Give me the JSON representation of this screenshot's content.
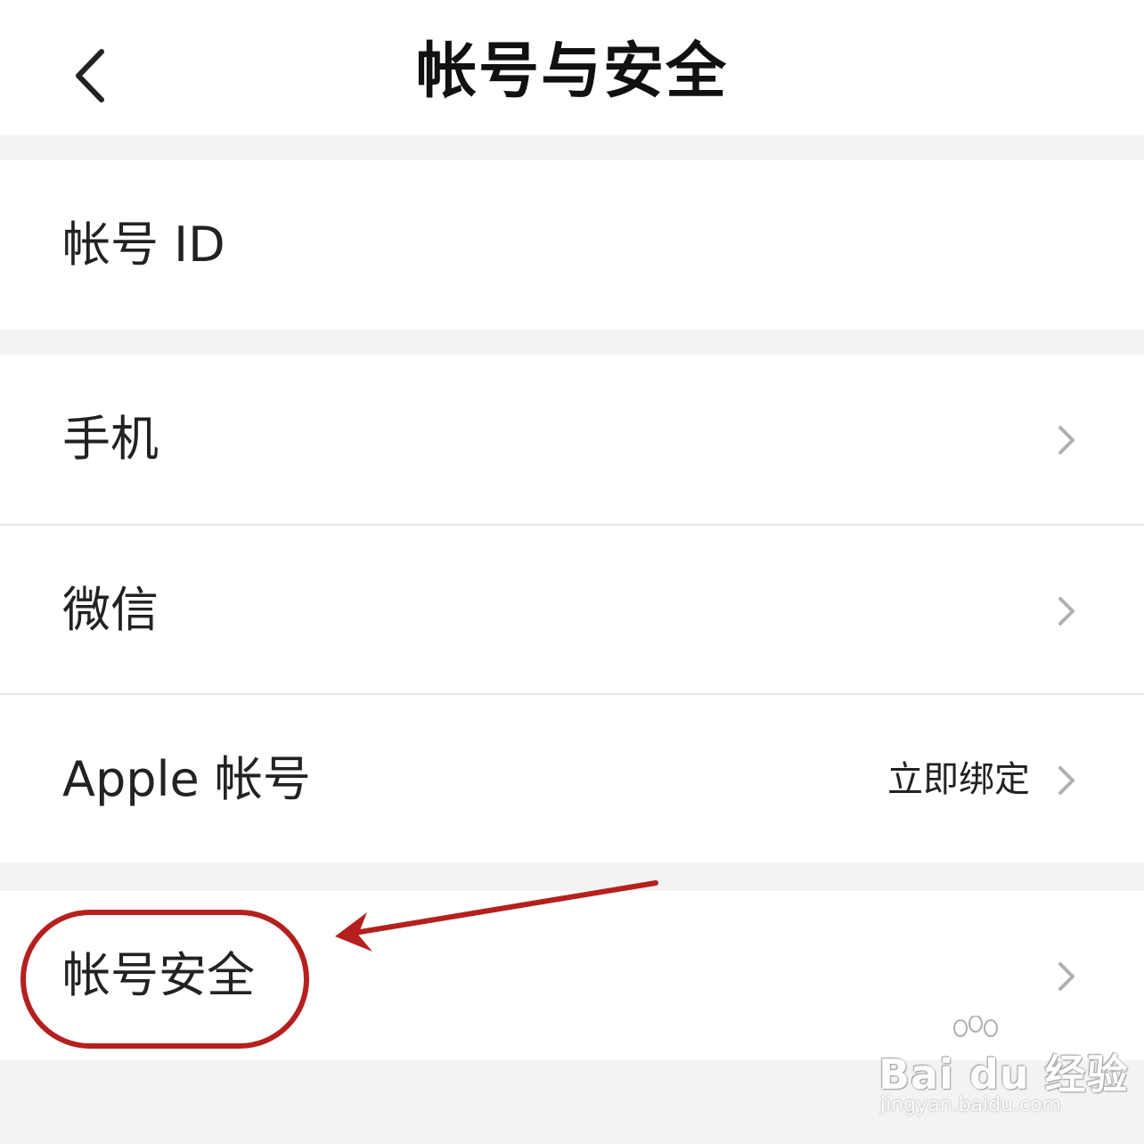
{
  "header": {
    "title": "帐号与安全"
  },
  "groups": [
    {
      "rows": [
        {
          "label": "帐号 ID",
          "value": ""
        }
      ]
    },
    {
      "rows": [
        {
          "label": "手机",
          "value": ""
        },
        {
          "label": "微信",
          "value": ""
        },
        {
          "label": "Apple 帐号",
          "value": "立即绑定"
        }
      ]
    },
    {
      "rows": [
        {
          "label": "帐号安全",
          "value": ""
        }
      ]
    }
  ],
  "annotation": {
    "color": "#b5201e"
  },
  "watermark": {
    "brand": "Bai du 经验",
    "url": "jingyan.baidu.com"
  }
}
